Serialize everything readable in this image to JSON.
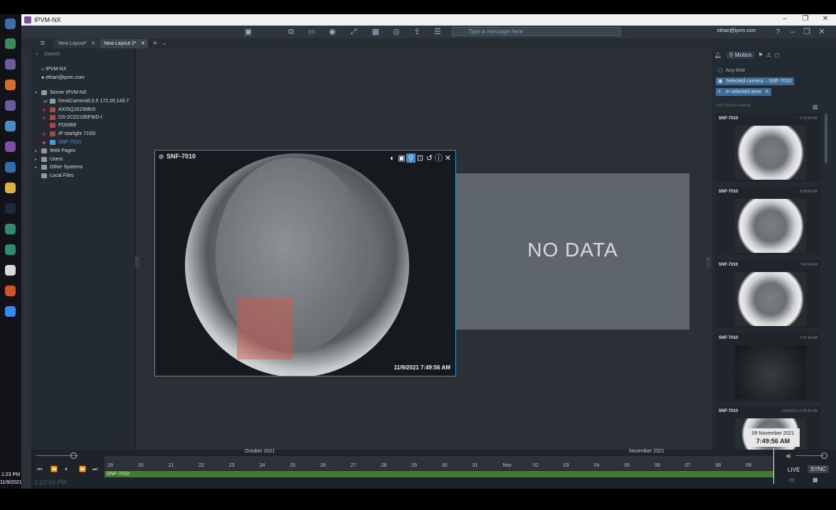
{
  "window": {
    "title": "IPVM-NX"
  },
  "taskbar": {
    "time": "1:23 PM",
    "date": "11/9/2021"
  },
  "toolbar": {
    "message_placeholder": "Type a message here",
    "user": "ethan@ipvm.com"
  },
  "tabs": [
    {
      "label": "New Layout*"
    },
    {
      "label": "New Layout 2*"
    }
  ],
  "left_panel": {
    "search_placeholder": "Search",
    "system_name": "IPVM-NX",
    "user": "ethan@ipvm.com",
    "server": "Server IPVM-NX",
    "cameras": [
      "DeskCamera5.0.5 172.20.143.7",
      "AXISQ1615MkIII",
      "DS-2CD2185FWD-I",
      "FD9369",
      "IP starlight 7100i",
      "SNF-7010"
    ],
    "groups": [
      "Web Pages",
      "Users",
      "Other Systems",
      "Local Files"
    ]
  },
  "camera_item": {
    "name": "SNF-7010",
    "timestamp": "11/9/2021 7:49:56 AM"
  },
  "nodata_item": {
    "text": "NO DATA"
  },
  "right_panel": {
    "tab_motion": "Motion",
    "filter_any_time": "Any time",
    "filter_camera": "Selected camera – SNF-7010",
    "filter_area": "In selected area",
    "events_count": "+99 motion events",
    "events": [
      {
        "camera": "SNF-7010",
        "time": "9:14:38 AM"
      },
      {
        "camera": "SNF-7010",
        "time": "8:05:59 AM"
      },
      {
        "camera": "SNF-7010",
        "time": "7:49:54 AM"
      },
      {
        "camera": "SNF-7010",
        "time": "7:22:10 AM"
      },
      {
        "camera": "SNF-7010",
        "time": "11/8/2021, 6:28:35 PM"
      }
    ]
  },
  "timeline": {
    "month_oct": "October 2021",
    "month_nov": "November 2021",
    "ticks": [
      "19",
      "20",
      "21",
      "22",
      "23",
      "24",
      "25",
      "26",
      "27",
      "28",
      "29",
      "30",
      "31",
      "Nov",
      "02",
      "03",
      "04",
      "05",
      "06",
      "07",
      "08",
      "09"
    ],
    "chunk_label": "SNF-7010",
    "current_time": "1:23:04 PM",
    "tooltip_date": "09 November 2021",
    "tooltip_time": "7:49:56 AM",
    "live_label": "LIVE",
    "sync_label": "SYNC"
  }
}
